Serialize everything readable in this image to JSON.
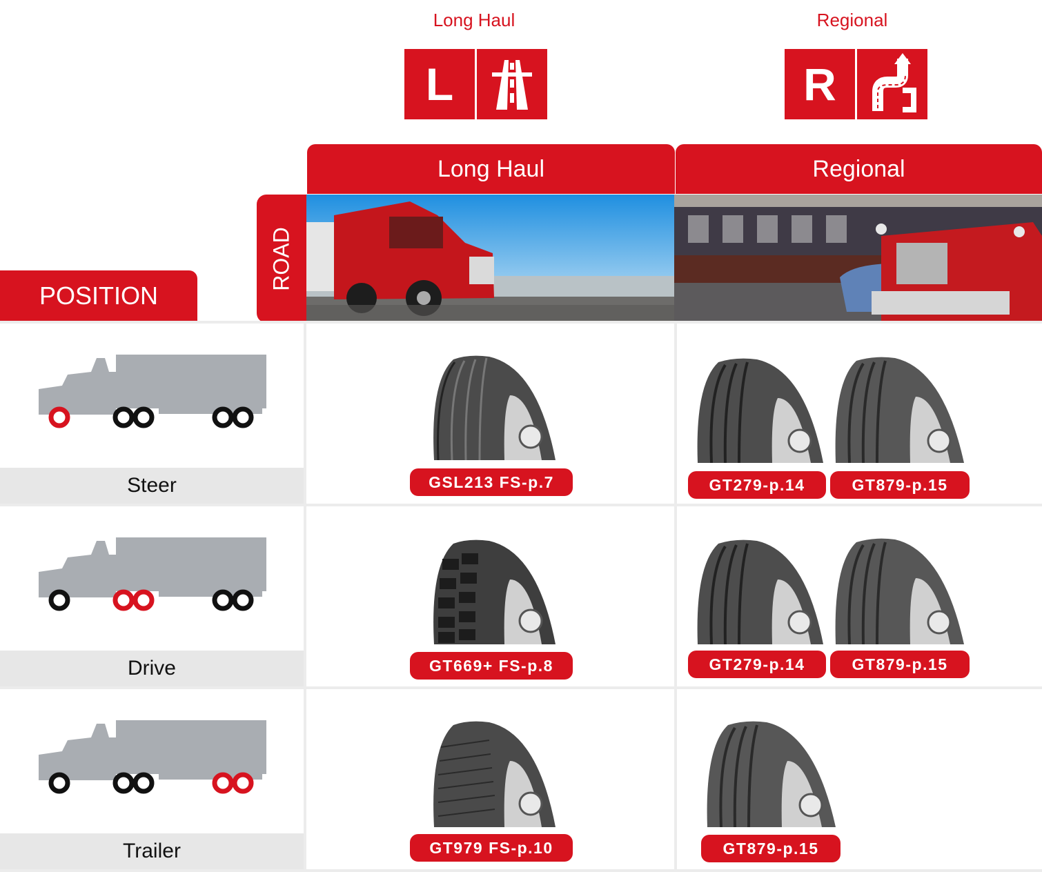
{
  "categories": [
    {
      "label": "Long Haul",
      "icon_letter": "L",
      "icon": "highway-icon"
    },
    {
      "label": "Regional",
      "icon_letter": "R",
      "icon": "winding-road-icon"
    }
  ],
  "columns": [
    {
      "header": "Long Haul",
      "photo": "red truck on highway"
    },
    {
      "header": "Regional",
      "photo": "red truck in city street"
    }
  ],
  "road_label": "ROAD",
  "position_label": "POSITION",
  "rows": [
    {
      "position": "Steer",
      "long_haul": [
        "GSL213 FS-p.7"
      ],
      "regional": [
        "GT279-p.14",
        "GT879-p.15"
      ]
    },
    {
      "position": "Drive",
      "long_haul": [
        "GT669+ FS-p.8"
      ],
      "regional": [
        "GT279-p.14",
        "GT879-p.15"
      ]
    },
    {
      "position": "Trailer",
      "long_haul": [
        "GT979 FS-p.10"
      ],
      "regional": [
        "GT879-p.15"
      ]
    }
  ],
  "colors": {
    "accent": "#d7131f",
    "truck_gray": "#a9adb2",
    "label_bg": "#e7e7e7"
  }
}
